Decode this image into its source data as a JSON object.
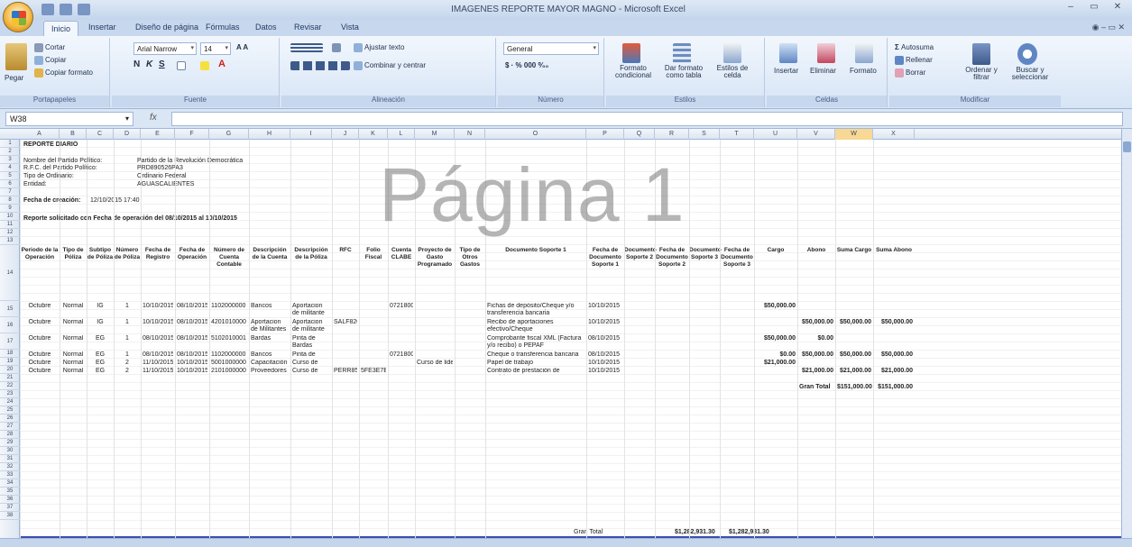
{
  "window": {
    "title": "IMAGENES REPORTE MAYOR MAGNO - Microsoft Excel",
    "controls": [
      "–",
      "▭",
      "✕"
    ],
    "help_controls": "◉ – ▭ ✕"
  },
  "tabs": [
    "Inicio",
    "Insertar",
    "Diseño de página",
    "Fórmulas",
    "Datos",
    "Revisar",
    "Vista"
  ],
  "ribbon": {
    "clipboard": {
      "paste": "Pegar",
      "cut": "Cortar",
      "copy": "Copiar",
      "format_painter": "Copiar formato",
      "label": "Portapapeles"
    },
    "font": {
      "name": "Arial Narrow",
      "size": "14",
      "bold": "N",
      "italic": "K",
      "underline": "S",
      "label": "Fuente"
    },
    "alignment": {
      "wrap": "Ajustar texto",
      "merge": "Combinar y centrar",
      "label": "Alineación"
    },
    "number": {
      "format": "General",
      "label": "Número"
    },
    "styles": {
      "conditional": "Formato condicional",
      "table": "Dar formato como tabla",
      "cell_styles": "Estilos de celda",
      "label": "Estilos"
    },
    "cells": {
      "insert": "Insertar",
      "delete": "Eliminar",
      "format": "Formato",
      "label": "Celdas"
    },
    "editing": {
      "autosum": "Autosuma",
      "fill": "Rellenar",
      "clear": "Borrar",
      "sort": "Ordenar y filtrar",
      "find": "Buscar y seleccionar",
      "label": "Modificar"
    }
  },
  "formula_bar": {
    "name_box": "W38",
    "fx": "fx",
    "formula": ""
  },
  "columns": [
    "A",
    "B",
    "C",
    "D",
    "E",
    "F",
    "G",
    "H",
    "I",
    "J",
    "K",
    "L",
    "M",
    "N",
    "O",
    "P",
    "Q",
    "R",
    "S",
    "T",
    "U",
    "V",
    "W",
    "X"
  ],
  "selected_column": "W",
  "rows": [
    "1",
    "2",
    "3",
    "4",
    "5",
    "6",
    "7",
    "8",
    "9",
    "10",
    "11",
    "12",
    "13",
    "14",
    "15",
    "16",
    "17",
    "18",
    "19",
    "20",
    "21",
    "22",
    "23",
    "24",
    "25",
    "26",
    "27",
    "28",
    "29",
    "30",
    "31",
    "32",
    "33",
    "34",
    "35",
    "36",
    "37",
    "38"
  ],
  "report": {
    "title": "REPORTE DIARIO",
    "party_label": "Nombre del Partido Político:",
    "party_value": "Partido de la Revolución Democrática",
    "rfc_label": "R.F.C. del Partido Político:",
    "rfc_value": "PRD890526PA3",
    "type_label": "Tipo de Ordinario:",
    "type_value": "Ordinario Federal",
    "entity_label": "Entidad:",
    "entity_value": "AGUASCALIENTES",
    "created_label": "Fecha de creación:",
    "created_value": "12/10/2015 17:40",
    "requested": "Reporte solicitado con Fecha de operación del 08/10/2015 al 10/10/2015"
  },
  "table": {
    "headers": [
      "Periodo de la Operación",
      "Tipo de Póliza",
      "Subtipo de Póliza",
      "Número de Póliza",
      "Fecha de Registro",
      "Fecha de Operación",
      "Número de Cuenta Contable",
      "Descripción de la Cuenta",
      "Descripción de la Póliza",
      "RFC",
      "Folio Fiscal",
      "Cuenta CLABE",
      "Proyecto de Gasto Programado",
      "Tipo de Otros Gastos",
      "Documento Soporte 1",
      "Fecha de Documento Soporte 1",
      "Documento Soporte 2",
      "Fecha de Documento Soporte 2",
      "Documento Soporte 3",
      "Fecha de Documento Soporte 3",
      "Cargo",
      "Abono",
      "Suma Cargo",
      "Suma Abono"
    ],
    "rows": [
      [
        "Octubre",
        "Normal",
        "IG",
        "1",
        "10/10/2015",
        "08/10/2015",
        "1102000000",
        "Bancos",
        "Aportacion de militante",
        "",
        "",
        "072180000...",
        "",
        "",
        "Fichas de depósito/Cheque y/o transferencia bancaria",
        "10/10/2015",
        "",
        "",
        "",
        "",
        "$50,000.00",
        "",
        "",
        ""
      ],
      [
        "Octubre",
        "Normal",
        "IG",
        "1",
        "10/10/2015",
        "08/10/2015",
        "4201010000",
        "Aportacion de Militantes",
        "Aportacion de militante",
        "SALF820506...",
        "",
        "",
        "",
        "",
        "Recibo de aportaciones efectivo/Cheque",
        "10/10/2015",
        "",
        "",
        "",
        "",
        "",
        "$50,000.00",
        "$50,000.00",
        "$50,000.00"
      ],
      [
        "Octubre",
        "Normal",
        "EG",
        "1",
        "08/10/2015",
        "08/10/2015",
        "5102010001",
        "Bardas",
        "Pinta de Bardas",
        "",
        "",
        "",
        "",
        "",
        "Comprobante fiscal XML (Factura y/o recibo) o PEPAF",
        "08/10/2015",
        "",
        "",
        "",
        "",
        "$50,000.00",
        "$0.00",
        "",
        ""
      ],
      [
        "Octubre",
        "Normal",
        "EG",
        "1",
        "08/10/2015",
        "08/10/2015",
        "1102000000",
        "Bancos",
        "Pinta de",
        "",
        "",
        "072180000...",
        "",
        "",
        "Cheque o transferencia bancaria",
        "08/10/2015",
        "",
        "",
        "",
        "",
        "$0.00",
        "$50,000.00",
        "$50,000.00",
        "$50,000.00"
      ],
      [
        "Octubre",
        "Normal",
        "EG",
        "2",
        "11/10/2015",
        "10/10/2015",
        "5001000000",
        "Capacitación",
        "Curso de",
        "",
        "",
        "",
        "Curso de liderazgo",
        "",
        "Papel de trabajo",
        "10/10/2015",
        "",
        "",
        "",
        "",
        "$21,000.00",
        "",
        "",
        ""
      ],
      [
        "Octubre",
        "Normal",
        "EG",
        "2",
        "11/10/2015",
        "10/10/2015",
        "2101000000",
        "Proveedores",
        "Curso de",
        "PERR850...",
        "5FE3E7E0-8025-6012-819C-6F55DE26C1C3",
        "",
        "",
        "",
        "Contrato de prestación de servicios",
        "10/10/2015",
        "",
        "",
        "",
        "",
        "",
        "$21,000.00",
        "$21,000.00",
        "$21,000.00"
      ]
    ],
    "gran_total_label": "Gran Total",
    "gran_total_suma_cargo": "$151,000.00",
    "gran_total_suma_abono": "$151,000.00",
    "bottom_label": "Gran Total",
    "bottom_cargo": "$1,282,931.30",
    "bottom_abono": "$1,282,931.30"
  },
  "watermark": "Página 1",
  "colors": {
    "ribbon_blue": "#d6e4f5",
    "accent": "#3b4fb0",
    "selected_col": "#f7d894"
  }
}
